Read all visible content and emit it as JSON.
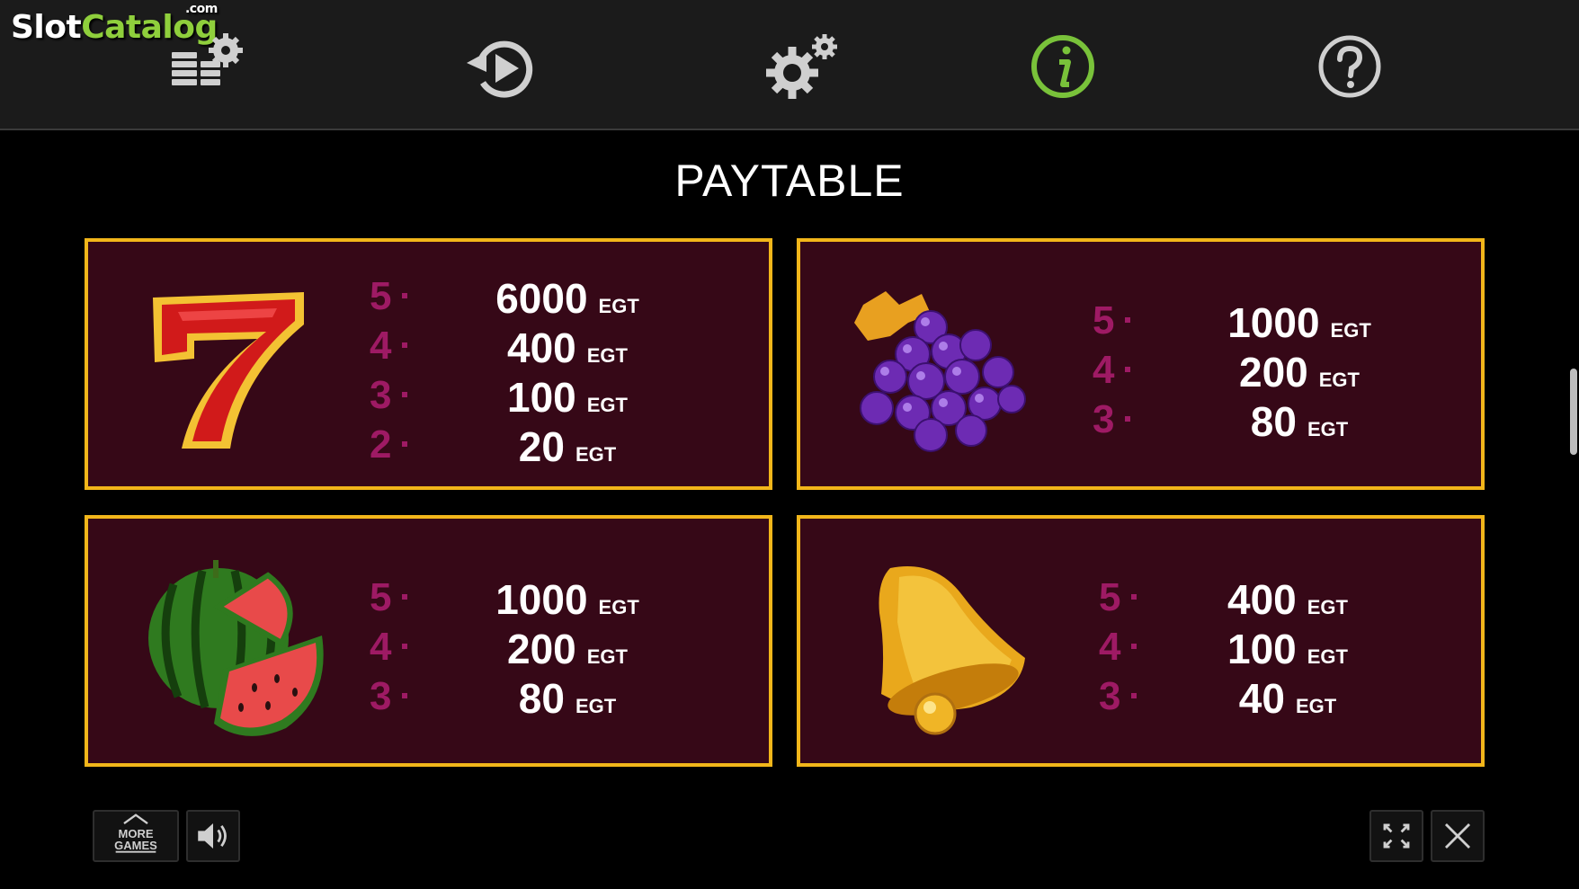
{
  "watermark": {
    "slot": "Slot",
    "catalog": "Catalog",
    "com": ".com"
  },
  "toolbar": {
    "icons": [
      "bet-settings-icon",
      "autoplay-icon",
      "settings-icon",
      "info-icon",
      "help-icon"
    ],
    "active": "info-icon",
    "active_color": "#79c23a"
  },
  "title": "PAYTABLE",
  "colors": {
    "panel_bg": "#360817",
    "panel_border": "#f2b61a",
    "count": "#9e1a64"
  },
  "paytable": [
    {
      "symbol": "seven",
      "rows": [
        {
          "count": "5",
          "amount": "6000",
          "currency": "EGT"
        },
        {
          "count": "4",
          "amount": "400",
          "currency": "EGT"
        },
        {
          "count": "3",
          "amount": "100",
          "currency": "EGT"
        },
        {
          "count": "2",
          "amount": "20",
          "currency": "EGT"
        }
      ]
    },
    {
      "symbol": "grapes",
      "rows": [
        {
          "count": "5",
          "amount": "1000",
          "currency": "EGT"
        },
        {
          "count": "4",
          "amount": "200",
          "currency": "EGT"
        },
        {
          "count": "3",
          "amount": "80",
          "currency": "EGT"
        }
      ]
    },
    {
      "symbol": "watermelon",
      "rows": [
        {
          "count": "5",
          "amount": "1000",
          "currency": "EGT"
        },
        {
          "count": "4",
          "amount": "200",
          "currency": "EGT"
        },
        {
          "count": "3",
          "amount": "80",
          "currency": "EGT"
        }
      ]
    },
    {
      "symbol": "bell",
      "rows": [
        {
          "count": "5",
          "amount": "400",
          "currency": "EGT"
        },
        {
          "count": "4",
          "amount": "100",
          "currency": "EGT"
        },
        {
          "count": "3",
          "amount": "40",
          "currency": "EGT"
        }
      ]
    }
  ],
  "bottom": {
    "more_games_line1": "MORE",
    "more_games_line2": "GAMES",
    "icons": [
      "sound-icon",
      "fullscreen-icon",
      "close-icon"
    ]
  }
}
